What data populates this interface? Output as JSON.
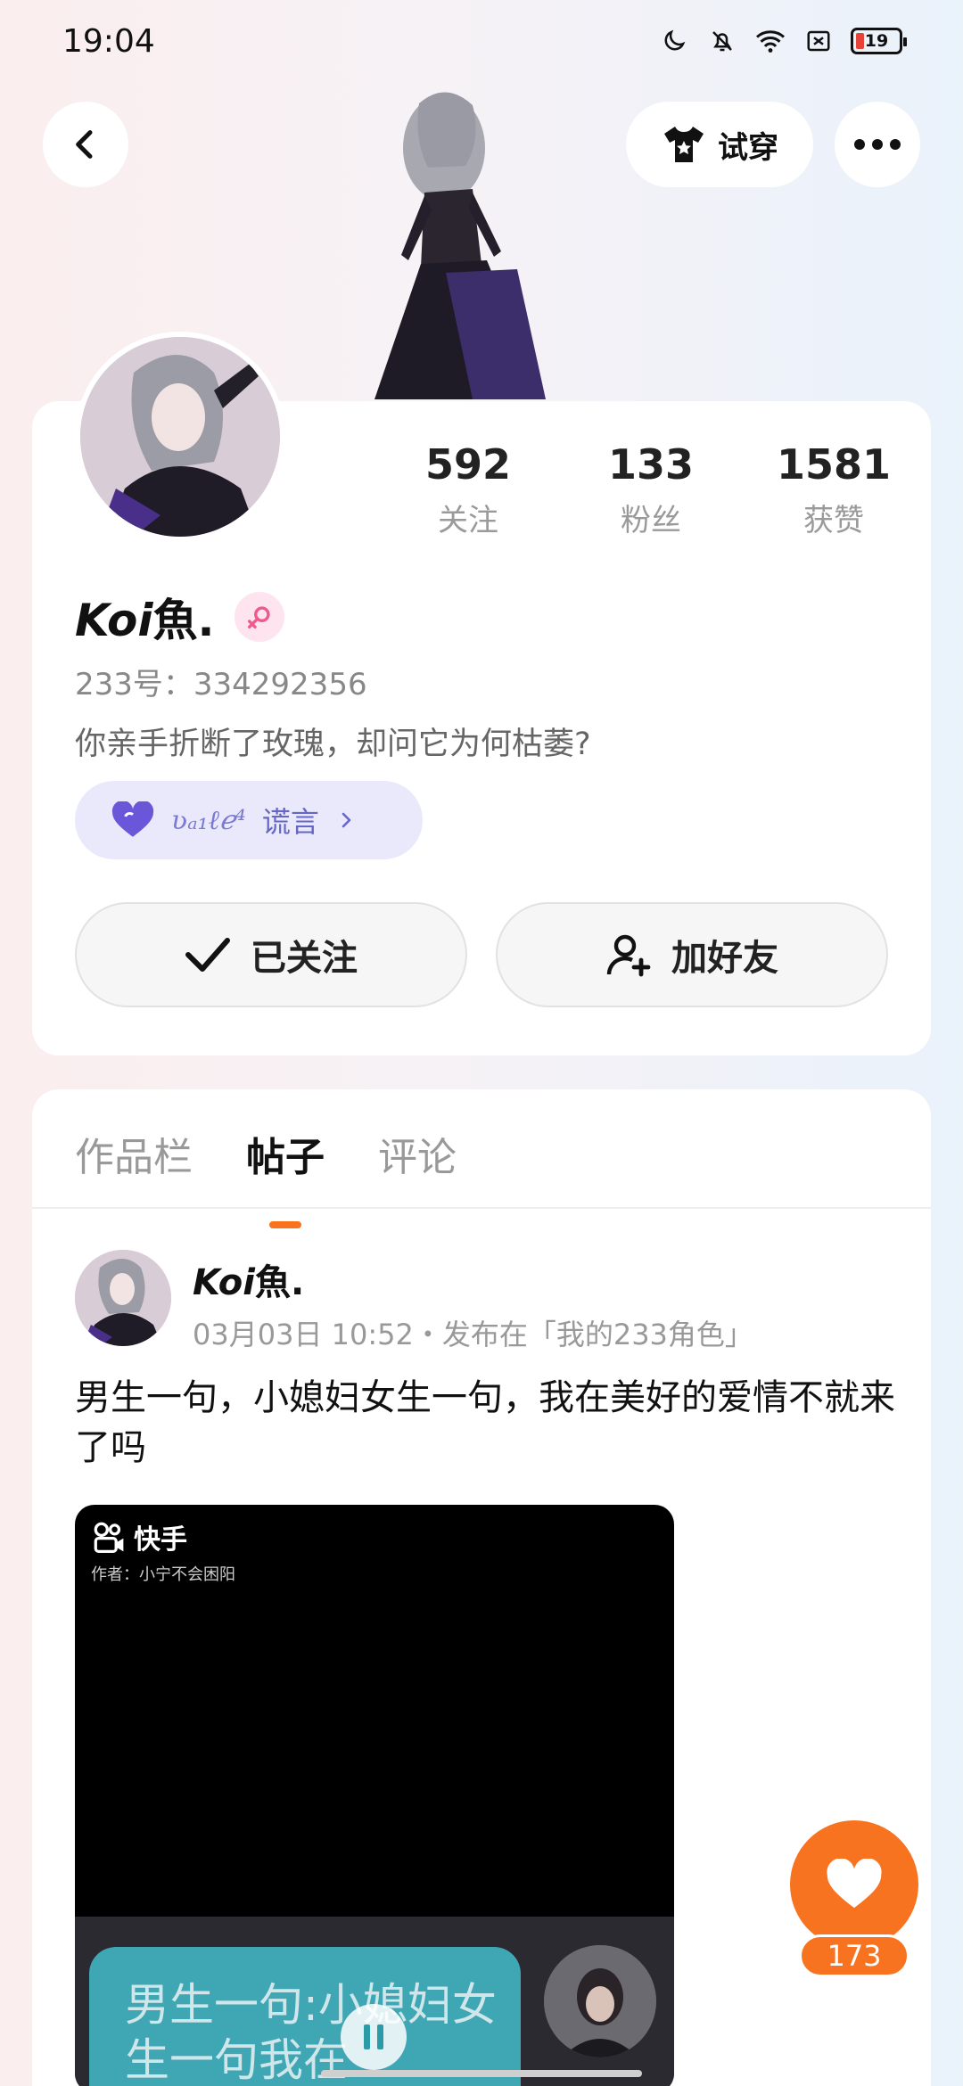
{
  "status_bar": {
    "time": "19:04",
    "battery_level": "19"
  },
  "header": {
    "try_on_label": "试穿"
  },
  "profile": {
    "stats": [
      {
        "value": "592",
        "label": "关注"
      },
      {
        "value": "133",
        "label": "粉丝"
      },
      {
        "value": "1581",
        "label": "获赞"
      }
    ],
    "name_italic": "Koi",
    "name_rest": "魚.",
    "uid": "233号：334292356",
    "bio": "你亲手折断了玫瑰，却问它为何枯萎?",
    "tag": {
      "deco": "ʋₐ₁ℓℯ⁴",
      "label": "谎言"
    },
    "follow_button": "已关注",
    "add_friend_button": "加好友"
  },
  "tabs": [
    {
      "label": "作品栏",
      "active": false
    },
    {
      "label": "帖子",
      "active": true
    },
    {
      "label": "评论",
      "active": false
    }
  ],
  "post": {
    "author_italic": "Koi",
    "author_rest": "魚.",
    "meta": "03月03日 10:52・发布在「我的233角色」",
    "text": "男生一句，小媳妇女生一句，我在美好的爱情不就来了吗",
    "video": {
      "brand": "快手",
      "author_line": "作者：小宁不会困阳",
      "bubble_text": "男生一句:小媳妇女生一句我在"
    }
  },
  "like": {
    "count": "173"
  },
  "colors": {
    "accent": "#f7731f",
    "tag_bg": "#e9e9fb",
    "tag_text": "#6666c8"
  }
}
